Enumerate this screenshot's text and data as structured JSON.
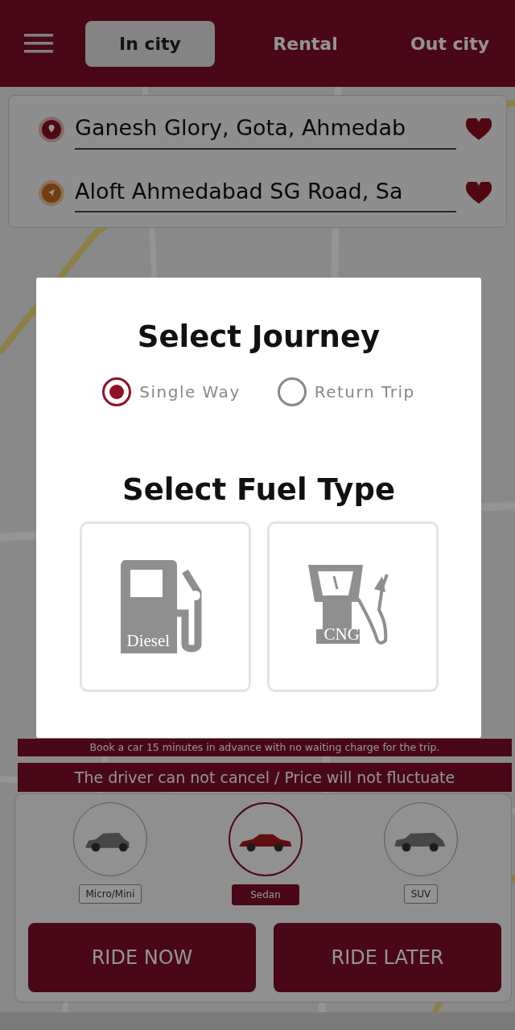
{
  "tabs": [
    {
      "label": "In city",
      "selected": true
    },
    {
      "label": "Rental",
      "selected": false
    },
    {
      "label": "Out city",
      "selected": false
    }
  ],
  "route": [
    {
      "kind": "pickup",
      "value": "Ganesh Glory, Gota, Ahmedab"
    },
    {
      "kind": "drop",
      "value": "Aloft Ahmedabad SG Road, Sa"
    }
  ],
  "notices": [
    "Book a car 15 minutes in advance with no waiting charge for the trip.",
    "The driver can not cancel / Price will not fluctuate"
  ],
  "vehicles": [
    {
      "label": "Micro/Mini",
      "kind": "hatchback",
      "selected": false
    },
    {
      "label": "Sedan",
      "kind": "sedan",
      "selected": true
    },
    {
      "label": "SUV",
      "kind": "suv",
      "selected": false
    }
  ],
  "actions": [
    "RIDE NOW",
    "RIDE LATER"
  ],
  "modal": {
    "title": "Select Journey",
    "journey_options": [
      {
        "label": "Single Way",
        "selected": true
      },
      {
        "label": "Return Trip",
        "selected": false
      }
    ],
    "fuel_title": "Select Fuel Type",
    "fuel_types": [
      {
        "label": "Diesel",
        "kind": "diesel"
      },
      {
        "label": "CNG",
        "kind": "cng"
      }
    ]
  }
}
